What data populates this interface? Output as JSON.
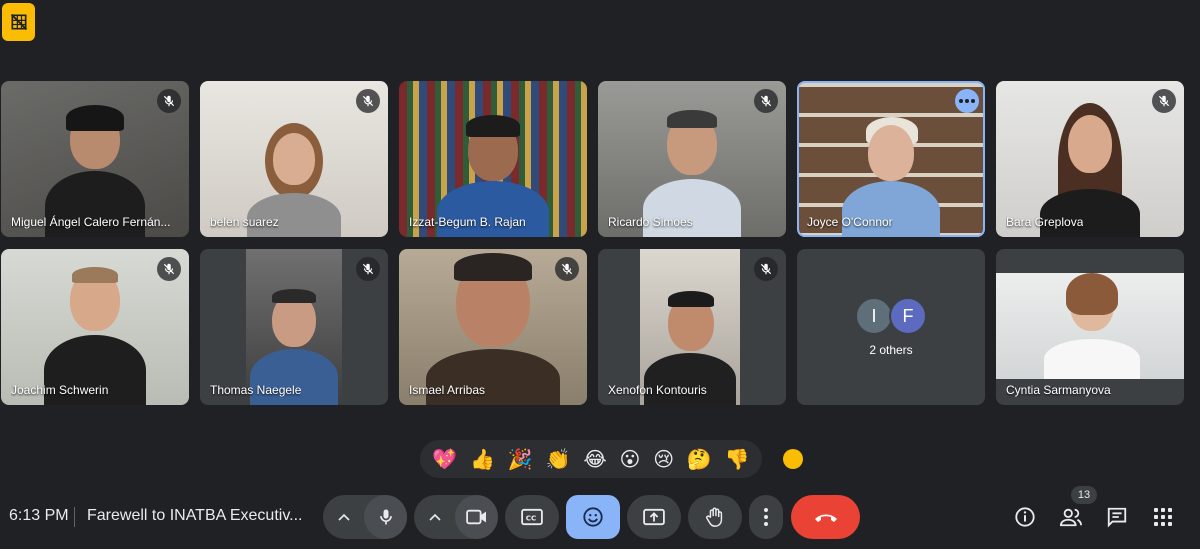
{
  "participants": [
    {
      "name": "Miguel Ángel Calero Fernán..."
    },
    {
      "name": "belen suarez"
    },
    {
      "name": "Izzat-Begum B. Rajan"
    },
    {
      "name": "Ricardo Simoes"
    },
    {
      "name": "Joyce O'Connor"
    },
    {
      "name": "Bara Greplova"
    },
    {
      "name": "Joachim Schwerin"
    },
    {
      "name": "Thomas Naegele"
    },
    {
      "name": "Ismael Arribas"
    },
    {
      "name": "Xenofon Kontouris"
    },
    {
      "name": "Cyntia Sarmanyova"
    }
  ],
  "others": {
    "initials": [
      "I",
      "F"
    ],
    "label": "2 others"
  },
  "reactions": [
    "💖",
    "👍",
    "🎉",
    "👏",
    "😂",
    "😮",
    "😢",
    "🤔",
    "👎"
  ],
  "meeting": {
    "time": "6:13 PM",
    "title": "Farewell to INATBA Executiv..."
  },
  "people_count": "13",
  "colors": {
    "accent": "#8ab4f8",
    "end_call": "#ea4335",
    "warning": "#fbbc04",
    "background": "#202124"
  }
}
